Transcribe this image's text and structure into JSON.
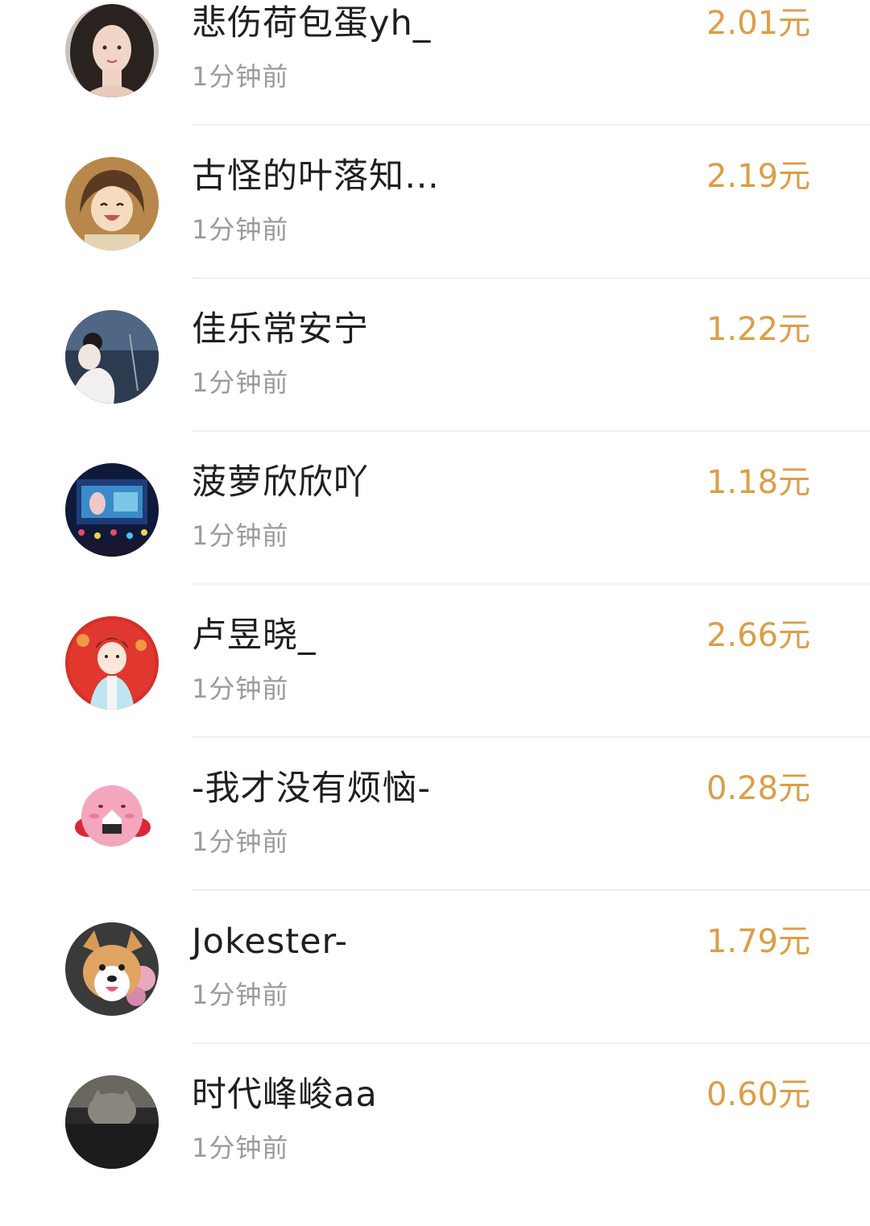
{
  "records": [
    {
      "name": "悲伤荷包蛋yh_",
      "time": "1分钟前",
      "amount": "2.01元",
      "avatar_icon": "woman-portrait-avatar"
    },
    {
      "name": "古怪的叶落知…",
      "time": "1分钟前",
      "amount": "2.19元",
      "avatar_icon": "cartoon-laughing-avatar"
    },
    {
      "name": "佳乐常安宁",
      "time": "1分钟前",
      "amount": "1.22元",
      "avatar_icon": "woman-by-lake-avatar"
    },
    {
      "name": "菠萝欣欣吖",
      "time": "1分钟前",
      "amount": "1.18元",
      "avatar_icon": "concert-stage-avatar"
    },
    {
      "name": "卢昱晓_",
      "time": "1分钟前",
      "amount": "2.66元",
      "avatar_icon": "chinese-costume-cartoon-avatar"
    },
    {
      "name": "-我才没有烦恼-",
      "time": "1分钟前",
      "amount": "0.28元",
      "avatar_icon": "pink-kirby-avatar"
    },
    {
      "name": "Jokester-",
      "time": "1分钟前",
      "amount": "1.79元",
      "avatar_icon": "corgi-dog-avatar"
    },
    {
      "name": "时代峰峻aa",
      "time": "1分钟前",
      "amount": "0.60元",
      "avatar_icon": "cat-photo-avatar"
    }
  ],
  "colors": {
    "amount": "#dd9d46",
    "name": "#1f1f1f",
    "time": "#9b9b9b",
    "divider": "#efefef"
  }
}
